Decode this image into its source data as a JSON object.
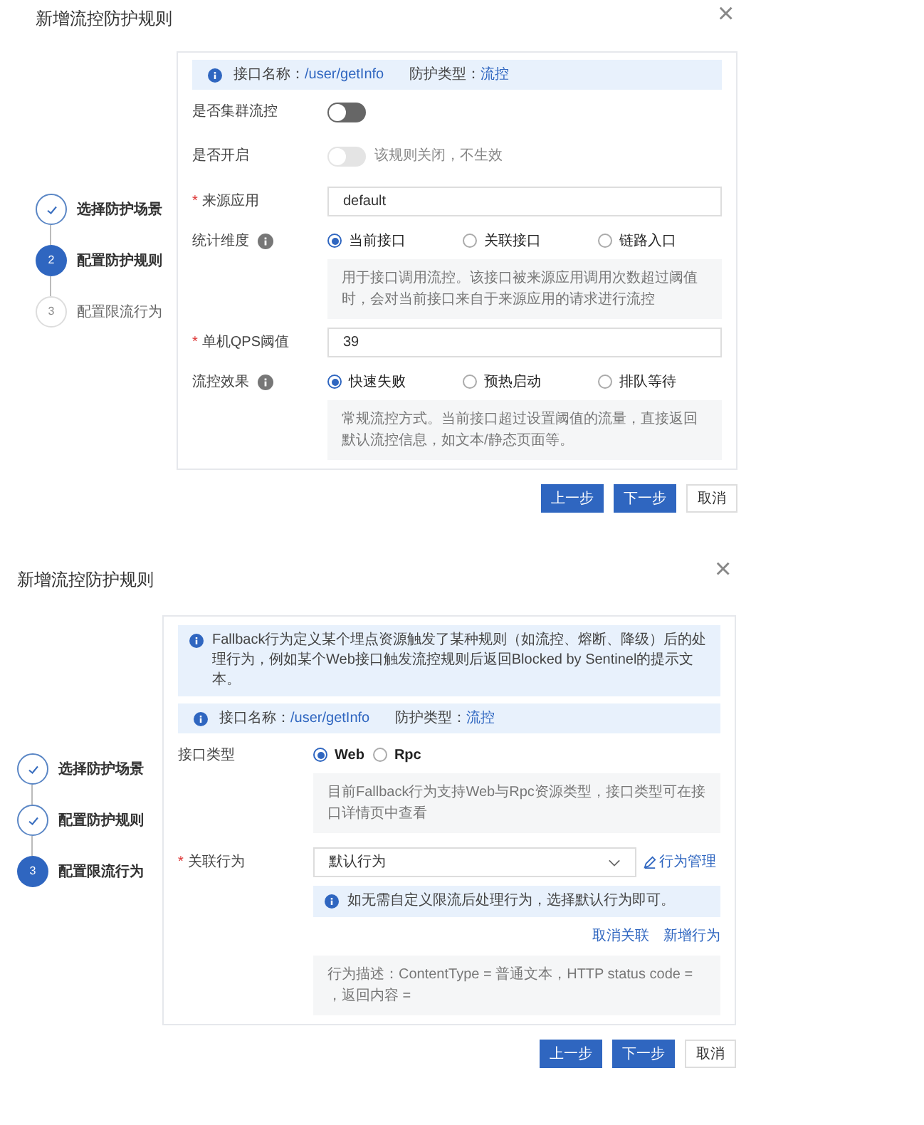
{
  "dialogs": [
    {
      "title": "新增流控防护规则",
      "close": "×",
      "steps": [
        {
          "label": "选择防护场景",
          "done": true
        },
        {
          "number": "2",
          "label": "配置防护规则",
          "done": false,
          "active": true
        },
        {
          "number": "3",
          "label": "配置限流行为",
          "done": false,
          "active": false
        }
      ],
      "rows": [
        {
          "kind": "info",
          "parts": [
            {
              "label": "接口名称：",
              "value": "/user/getInfo"
            },
            {
              "label": "防护类型：",
              "value": "流控"
            }
          ]
        },
        {
          "kind": "toggle",
          "label": "是否集群流控",
          "on": false,
          "disabled": false
        },
        {
          "kind": "toggle",
          "label": "是否开启",
          "on": false,
          "disabled": true,
          "hint": "该规则关闭，不生效"
        },
        {
          "kind": "input",
          "mark": "*",
          "label": "来源应用",
          "value": "default"
        },
        {
          "kind": "radio",
          "label": "统计维度",
          "help": true,
          "options": [
            {
              "label": "当前接口",
              "selected": true
            },
            {
              "label": "关联接口",
              "selected": false
            },
            {
              "label": "链路入口",
              "selected": false
            }
          ]
        },
        {
          "kind": "description",
          "text": "用于接口调用流控。该接口被来源应用调用次数超过阈值时，会对当前接口来自于来源应用的请求进行流控"
        },
        {
          "kind": "input",
          "mark": "*",
          "label": "单机QPS阈值",
          "value": "39"
        },
        {
          "kind": "radio",
          "label": "流控效果",
          "help": true,
          "options": [
            {
              "label": "快速失败",
              "selected": true
            },
            {
              "label": "预热启动",
              "selected": false
            },
            {
              "label": "排队等待",
              "selected": false
            }
          ]
        },
        {
          "kind": "description",
          "text": "常规流控方式。当前接口超过设置阈值的流量，直接返回默认流控信息，如文本/静态页面等。"
        }
      ],
      "buttons": [
        {
          "label": "上一步",
          "primary": true
        },
        {
          "label": "下一步",
          "primary": true
        },
        {
          "label": "取消",
          "primary": false
        }
      ]
    },
    {
      "title": "新增流控防护规则",
      "close": "×",
      "steps": [
        {
          "label": "选择防护场景",
          "done": true
        },
        {
          "label": "配置防护规则",
          "done": true
        },
        {
          "number": "3",
          "label": "配置限流行为",
          "done": false,
          "active": true
        }
      ],
      "rows": [
        {
          "kind": "notice",
          "text": "Fallback行为定义某个埋点资源触发了某种规则（如流控、熔断、降级）后的处理行为，例如某个Web接口触发流控规则后返回Blocked by Sentinel的提示文本。"
        },
        {
          "kind": "info",
          "parts": [
            {
              "label": "接口名称：",
              "value": "/user/getInfo"
            },
            {
              "label": "防护类型：",
              "value": "流控"
            }
          ]
        },
        {
          "kind": "radio",
          "label": "接口类型",
          "bold": true,
          "options": [
            {
              "label": "Web",
              "selected": true
            },
            {
              "label": "Rpc",
              "selected": false
            }
          ]
        },
        {
          "kind": "description",
          "text": "目前Fallback行为支持Web与Rpc资源类型，接口类型可在接口详情页中查看"
        },
        {
          "kind": "select",
          "mark": "*",
          "label": "关联行为",
          "value": "默认行为",
          "link": "行为管理"
        },
        {
          "kind": "notice",
          "text": "如无需自定义限流后处理行为，选择默认行为即可。"
        },
        {
          "kind": "links",
          "links": [
            "取消关联",
            "新增行为"
          ]
        },
        {
          "kind": "description",
          "text": "行为描述：ContentType = 普通文本，HTTP status code = ，返回内容 ="
        }
      ],
      "buttons": [
        {
          "label": "上一步",
          "primary": true
        },
        {
          "label": "下一步",
          "primary": true
        },
        {
          "label": "取消",
          "primary": false
        }
      ]
    }
  ]
}
